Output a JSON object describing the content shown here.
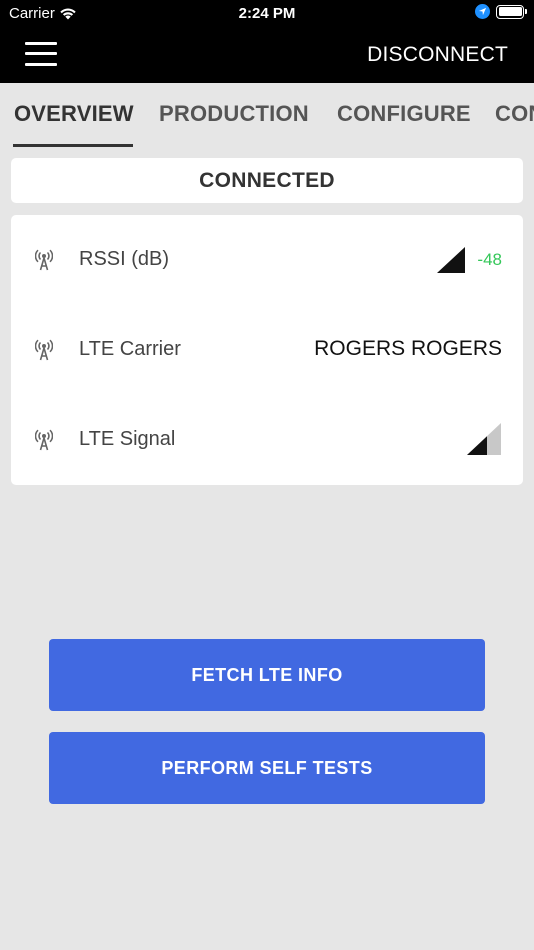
{
  "status_bar": {
    "carrier": "Carrier",
    "time": "2:24 PM",
    "battery_level": 1.0
  },
  "app_bar": {
    "disconnect_label": "DISCONNECT"
  },
  "tabs": [
    {
      "label": "OVERVIEW",
      "active": true
    },
    {
      "label": "PRODUCTION",
      "active": false
    },
    {
      "label": "CONFIGURE",
      "active": false
    },
    {
      "label": "CONFIGURATION",
      "active": false
    }
  ],
  "connection": {
    "status": "CONNECTED"
  },
  "info_rows": [
    {
      "label": "RSSI (dB)",
      "value": "-48",
      "icon": "antenna-icon"
    },
    {
      "label": "LTE Carrier",
      "value": "ROGERS ROGERS",
      "icon": "antenna-icon"
    },
    {
      "label": "LTE Signal",
      "value": "",
      "icon": "antenna-icon"
    }
  ],
  "buttons": {
    "fetch_lte_info": "FETCH LTE INFO",
    "perform_self_tests": "PERFORM SELF TESTS"
  },
  "colors": {
    "primary_button": "#4169e1",
    "rssi_value": "#34c759",
    "app_bar": "#000000",
    "background": "#e6e6e6"
  }
}
